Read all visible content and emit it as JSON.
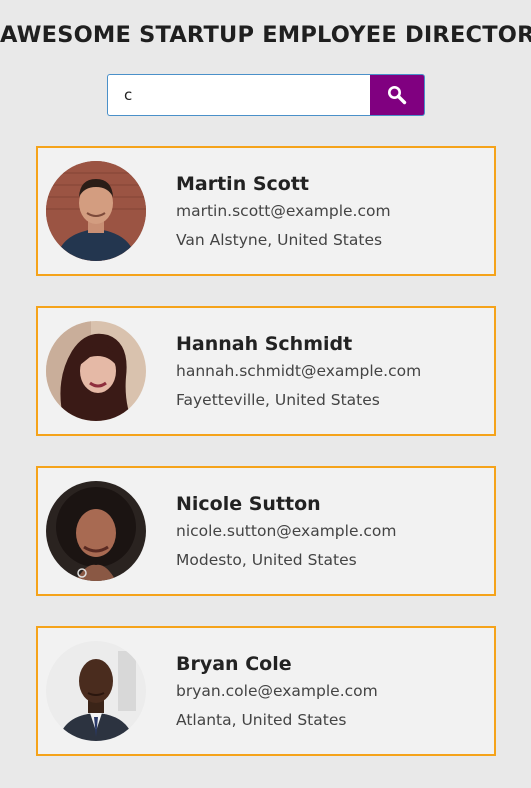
{
  "header": {
    "title": "AWESOME STARTUP EMPLOYEE DIRECTORY"
  },
  "search": {
    "value": "c",
    "button_icon": "search-icon",
    "button_color": "#800080"
  },
  "employees": [
    {
      "name": "Martin Scott",
      "email": "martin.scott@example.com",
      "location": "Van Alstyne, United States"
    },
    {
      "name": "Hannah Schmidt",
      "email": "hannah.schmidt@example.com",
      "location": "Fayetteville, United States"
    },
    {
      "name": "Nicole Sutton",
      "email": "nicole.sutton@example.com",
      "location": "Modesto, United States"
    },
    {
      "name": "Bryan Cole",
      "email": "bryan.cole@example.com",
      "location": "Atlanta, United States"
    }
  ],
  "colors": {
    "card_border": "#f5a31a",
    "background": "#e9e9e9"
  }
}
